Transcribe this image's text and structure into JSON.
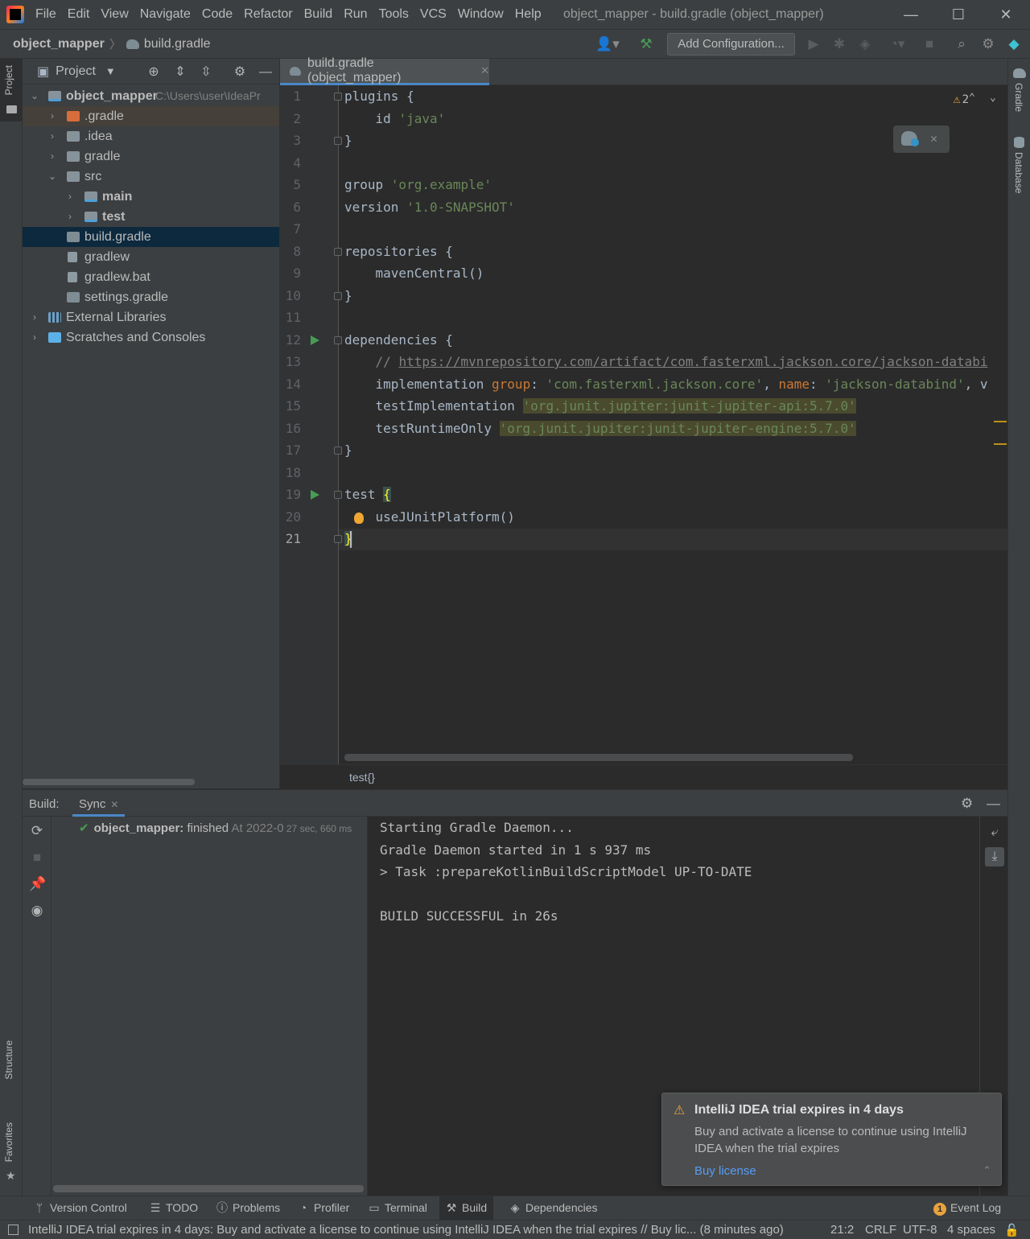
{
  "window": {
    "title": "object_mapper - build.gradle (object_mapper)",
    "controls": {
      "minimize": "—",
      "maximize": "☐",
      "close": "✕"
    }
  },
  "menu": [
    "File",
    "Edit",
    "View",
    "Navigate",
    "Code",
    "Refactor",
    "Build",
    "Run",
    "Tools",
    "VCS",
    "Window",
    "Help"
  ],
  "navbar": {
    "project": "object_mapper",
    "file": "build.gradle",
    "add_configuration": "Add Configuration..."
  },
  "left_strip": {
    "project": "Project",
    "structure": "Structure",
    "favorites": "Favorites"
  },
  "right_strip": {
    "gradle": "Gradle",
    "database": "Database"
  },
  "project_panel": {
    "title": "Project",
    "tree": [
      {
        "label": "object_mapper",
        "path": "C:\\Users\\user\\IdeaPr",
        "bold": true
      },
      {
        "label": ".gradle"
      },
      {
        "label": ".idea"
      },
      {
        "label": "gradle"
      },
      {
        "label": "src"
      },
      {
        "label": "main",
        "bold": true
      },
      {
        "label": "test",
        "bold": true
      },
      {
        "label": "build.gradle"
      },
      {
        "label": "gradlew"
      },
      {
        "label": "gradlew.bat"
      },
      {
        "label": "settings.gradle"
      },
      {
        "label": "External Libraries"
      },
      {
        "label": "Scratches and Consoles"
      }
    ]
  },
  "editor": {
    "tab_label": "build.gradle (object_mapper)",
    "warning_count": "2",
    "line_numbers": [
      "1",
      "2",
      "3",
      "4",
      "5",
      "6",
      "7",
      "8",
      "9",
      "10",
      "11",
      "12",
      "13",
      "14",
      "15",
      "16",
      "17",
      "18",
      "19",
      "20",
      "21"
    ],
    "code": {
      "l1_a": "plugins",
      "l1_b": " {",
      "l2_a": "    id ",
      "l2_b": "'java'",
      "l3": "}",
      "l5_a": "group ",
      "l5_b": "'org.example'",
      "l6_a": "version ",
      "l6_b": "'1.0-SNAPSHOT'",
      "l8": "repositories {",
      "l9": "    mavenCentral()",
      "l10": "}",
      "l12": "dependencies {",
      "l13_a": "    // ",
      "l13_b": "https://mvnrepository.com/artifact/com.fasterxml.jackson.core/jackson-databi",
      "l14_a": "    implementation ",
      "l14_b": "group",
      "l14_c": ": ",
      "l14_d": "'com.fasterxml.jackson.core'",
      "l14_e": ", ",
      "l14_f": "name",
      "l14_g": ": ",
      "l14_h": "'jackson-databind'",
      "l14_i": ", v",
      "l15_a": "    testImplementation ",
      "l15_b": "'org.junit.jupiter:junit-jupiter-api:5.7.0'",
      "l16_a": "    testRuntimeOnly ",
      "l16_b": "'org.junit.jupiter:junit-jupiter-engine:5.7.0'",
      "l17": "}",
      "l19_a": "test ",
      "l19_b": "{",
      "l20": "    useJUnitPlatform()",
      "l21": "}"
    },
    "breadcrumb": "test{}"
  },
  "build": {
    "title": "Build:",
    "tab": "Sync",
    "tree_project": "object_mapper:",
    "tree_status": " finished",
    "tree_time": " At 2022-0",
    "tree_duration": " 27 sec, 660 ms",
    "console": [
      "Starting Gradle Daemon...",
      "Gradle Daemon started in 1 s 937 ms",
      "> Task :prepareKotlinBuildScriptModel UP-TO-DATE",
      "",
      "BUILD SUCCESSFUL in 26s"
    ]
  },
  "notification": {
    "title": "IntelliJ IDEA trial expires in 4 days",
    "body": "Buy and activate a license to continue using IntelliJ IDEA when the trial expires",
    "link": "Buy license"
  },
  "bottom_tabs": {
    "version_control": "Version Control",
    "todo": "TODO",
    "problems": "Problems",
    "profiler": "Profiler",
    "terminal": "Terminal",
    "build": "Build",
    "dependencies": "Dependencies",
    "event_log": "Event Log",
    "event_log_count": "1"
  },
  "status_bar": {
    "message": "IntelliJ IDEA trial expires in 4 days: Buy and activate a license to continue using IntelliJ IDEA when the trial expires // Buy lic... (8 minutes ago)",
    "position": "21:2",
    "line_sep": "CRLF",
    "encoding": "UTF-8",
    "indent": "4 spaces"
  },
  "colors": {
    "background": "#2b2b2b",
    "panel": "#3c3f41",
    "keyword": "#cc7832",
    "string": "#6a8759",
    "accent": "#4a88c7",
    "success": "#499c54",
    "warning": "#e8a33e",
    "link": "#589df6"
  }
}
